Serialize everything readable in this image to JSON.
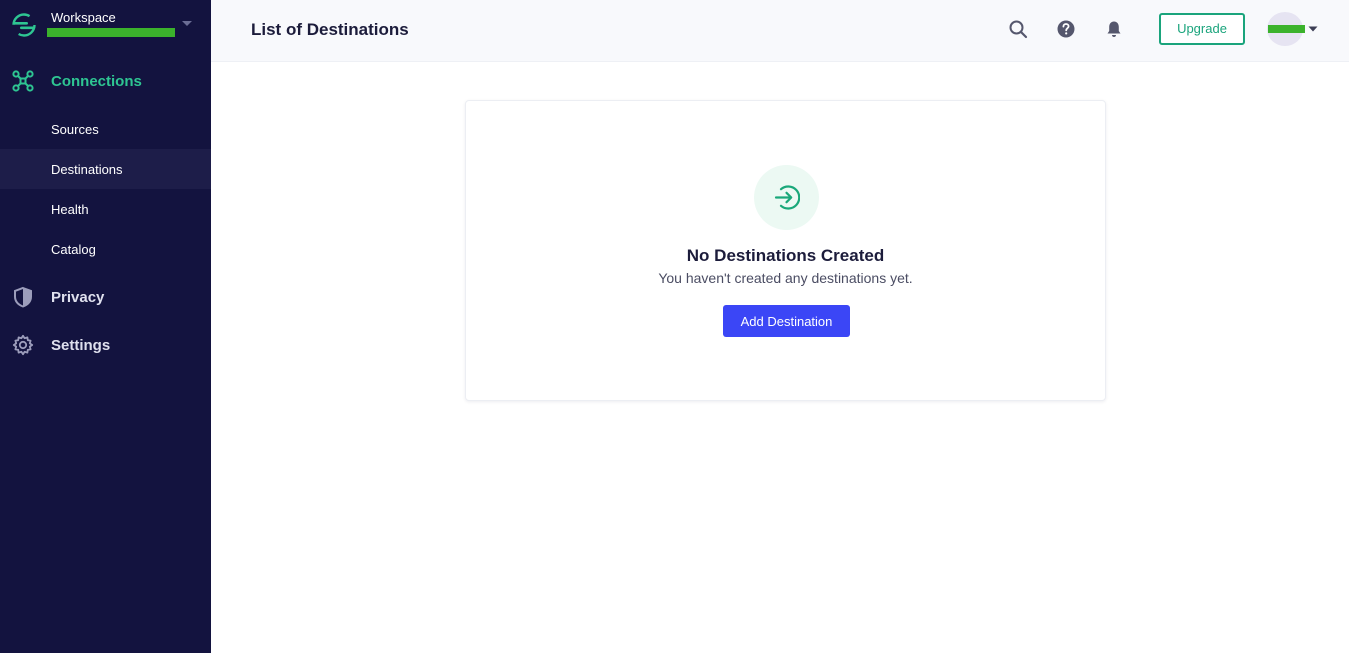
{
  "workspace": {
    "label": "Workspace",
    "icon": "segment-logo-icon",
    "chevron_icon": "chevron-down-icon"
  },
  "sidebar": {
    "connections": {
      "label": "Connections",
      "icon": "connections-icon"
    },
    "sub_items": [
      {
        "label": "Sources"
      },
      {
        "label": "Destinations",
        "active": true
      },
      {
        "label": "Health"
      },
      {
        "label": "Catalog"
      }
    ],
    "privacy": {
      "label": "Privacy",
      "icon": "shield-icon"
    },
    "settings": {
      "label": "Settings",
      "icon": "gear-icon"
    }
  },
  "header": {
    "title": "List of Destinations",
    "icons": [
      "search-icon",
      "help-icon",
      "bell-icon"
    ],
    "upgrade_label": "Upgrade"
  },
  "empty_state": {
    "icon": "arrow-right-circle-icon",
    "title": "No Destinations Created",
    "description": "You haven't created any destinations yet.",
    "button_label": "Add Destination"
  },
  "colors": {
    "sidebar_bg": "#13133f",
    "accent_green": "#2ec592",
    "primary_button": "#3b46f6",
    "upgrade_border": "#1aa47c"
  }
}
